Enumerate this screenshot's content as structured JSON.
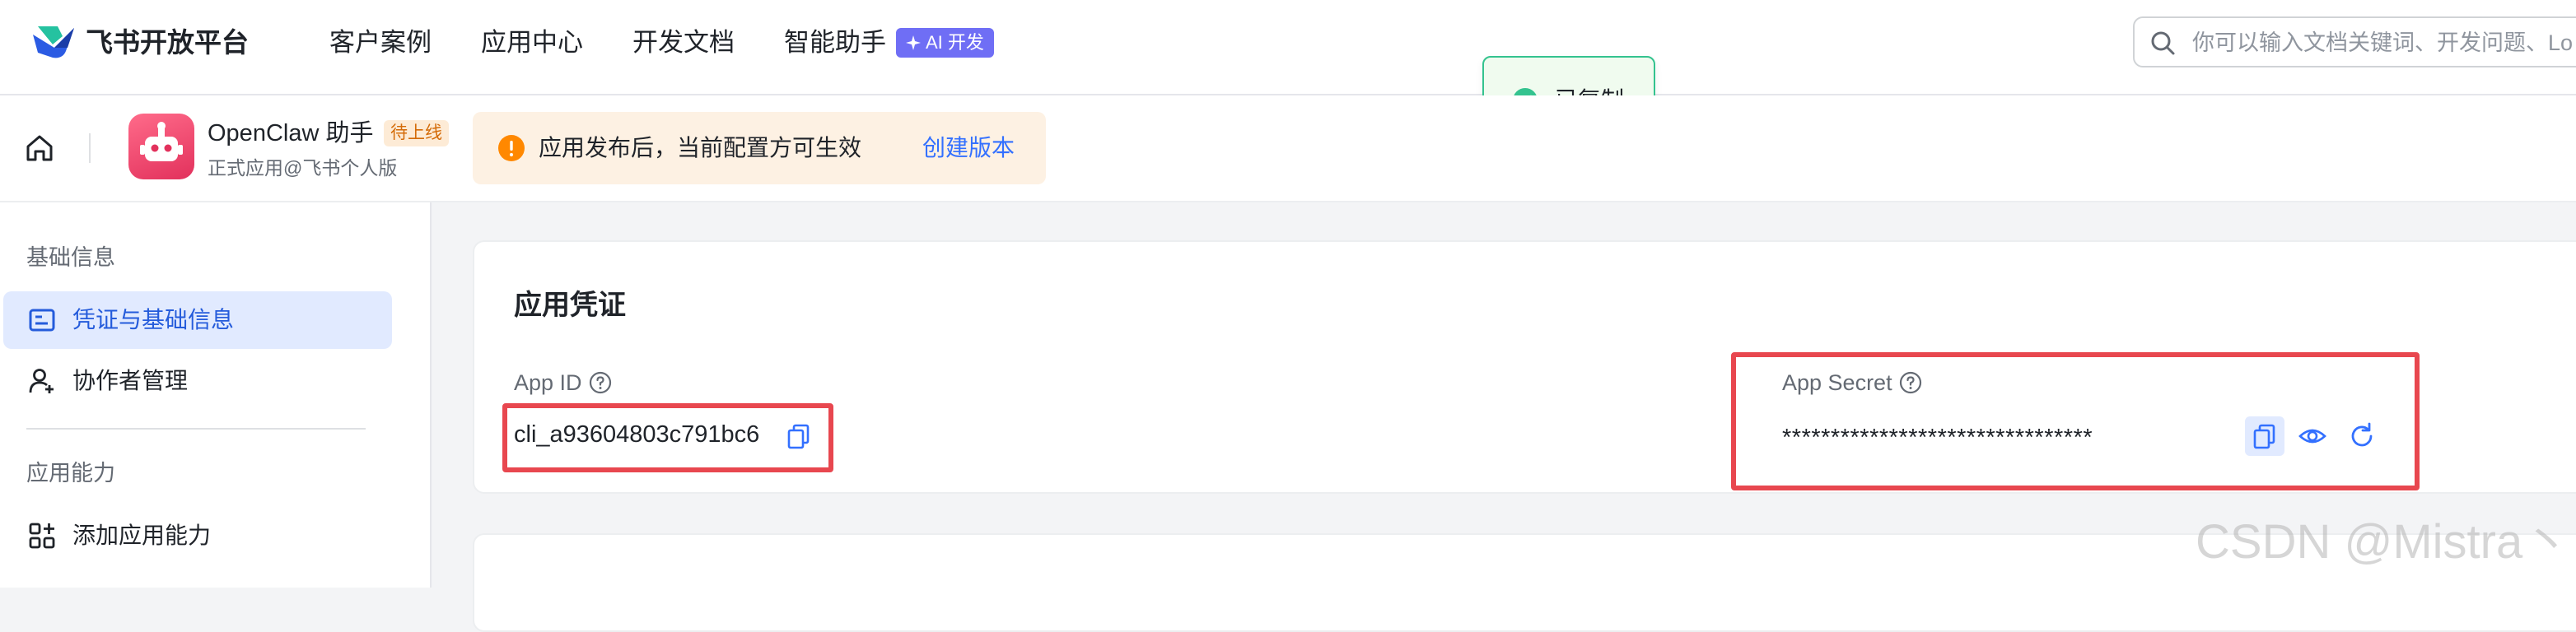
{
  "nav": {
    "brand": "飞书开放平台",
    "items": [
      "客户案例",
      "应用中心",
      "开发文档",
      "智能助手"
    ],
    "ai_badge": "AI 开发",
    "search_placeholder": "你可以输入文档关键词、开发问题、Lo"
  },
  "toast": {
    "text": "已复制"
  },
  "app": {
    "name": "OpenClaw 助手",
    "status_badge": "待上线",
    "subtitle": "正式应用@飞书个人版",
    "notice": "应用发布后，当前配置方可生效",
    "notice_link": "创建版本"
  },
  "sidebar": {
    "groups": [
      {
        "title": "基础信息",
        "items": [
          {
            "label": "凭证与基础信息",
            "icon": "credential-icon",
            "active": true
          },
          {
            "label": "协作者管理",
            "icon": "user-add-icon",
            "active": false
          }
        ]
      },
      {
        "title": "应用能力",
        "items": [
          {
            "label": "添加应用能力",
            "icon": "apps-add-icon",
            "active": false
          }
        ]
      }
    ]
  },
  "credentials": {
    "title": "应用凭证",
    "app_id_label": "App ID",
    "app_id_value": "cli_a93604803c791bc6",
    "app_secret_label": "App Secret",
    "app_secret_value": "********************************"
  },
  "watermark": "CSDN @Mistra丶",
  "colors": {
    "accent": "#3370ff",
    "highlight_border": "#e8474f",
    "success": "#34c38f",
    "warning": "#ff8800",
    "active_bg": "#e1eaff"
  }
}
